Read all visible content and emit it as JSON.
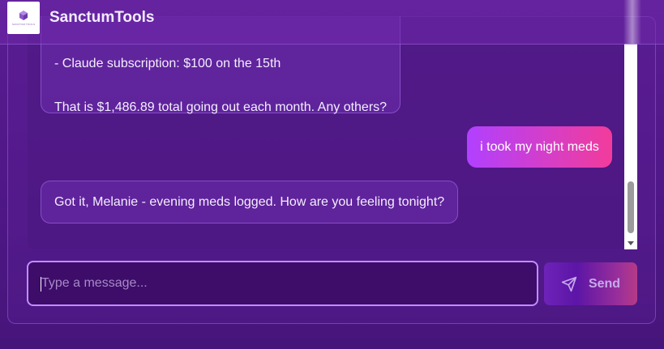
{
  "app": {
    "title": "SanctumTools",
    "logo_text": "SANCTUM TOOLS"
  },
  "chat": {
    "messages": [
      {
        "role": "assistant",
        "lines": [
          "- Claude subscription: $100 on the 15th",
          "That is $1,486.89 total going out each month. Any others?"
        ]
      },
      {
        "role": "user",
        "text": "i took my night meds"
      },
      {
        "role": "assistant",
        "text": "Got it, Melanie - evening meds logged. How are you feeling tonight?"
      }
    ]
  },
  "composer": {
    "placeholder": "Type a message...",
    "value": "",
    "send_label": "Send"
  },
  "colors": {
    "background": "#4f1787",
    "accent_start": "#b140ff",
    "accent_end": "#f23c9b",
    "input_border": "#c48cff"
  }
}
